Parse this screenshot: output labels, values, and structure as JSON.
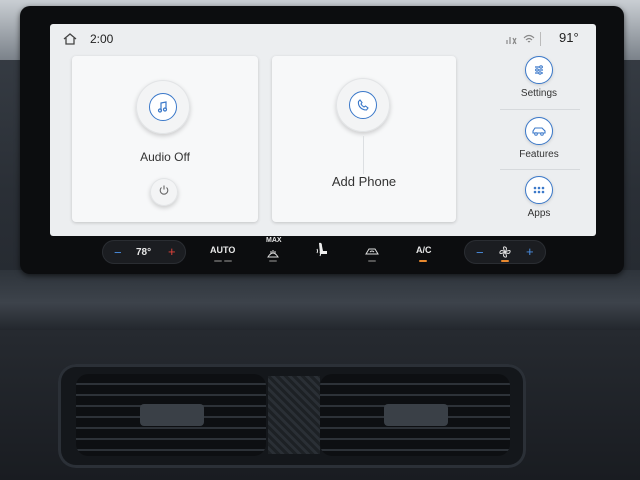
{
  "status_bar": {
    "time": "2:00",
    "outside_temp": "91°",
    "icons": [
      "home-icon",
      "phone-signal-icon",
      "wifi-icon"
    ]
  },
  "tiles": {
    "audio": {
      "label": "Audio Off",
      "icon": "music-note-icon",
      "power_icon": "power-icon"
    },
    "phone": {
      "label": "Add Phone",
      "icon": "phone-icon"
    }
  },
  "side_menu": [
    {
      "label": "Settings",
      "icon": "sliders-icon"
    },
    {
      "label": "Features",
      "icon": "car-icon"
    },
    {
      "label": "Apps",
      "icon": "apps-grid-icon"
    }
  ],
  "climate": {
    "driver_minus": "−",
    "driver_temp": "78°",
    "driver_plus": "+",
    "auto_label": "AUTO",
    "max_label": "MAX",
    "ac_label": "A/C",
    "fan_minus": "−",
    "fan_plus": "+",
    "colors": {
      "minus": "#4a8fe3",
      "plus": "#e2433b",
      "indicator_on": "#e8892f"
    }
  },
  "colors": {
    "accent": "#3a78c9",
    "screen_bg": "#eceef0"
  }
}
